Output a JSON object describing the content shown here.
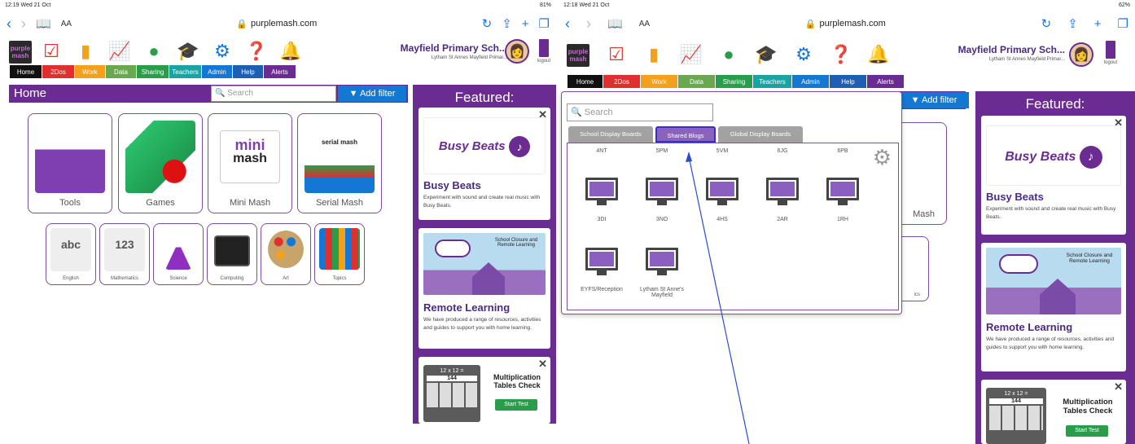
{
  "left": {
    "status_time": "12:19  Wed 21 Oct",
    "status_right": "81%",
    "url": "purplemash.com",
    "aa": "AA",
    "tabs": [
      "Home",
      "2Dos",
      "Work",
      "Data",
      "Sharing",
      "Teachers",
      "Admin",
      "Help",
      "Alerts"
    ],
    "school_name": "Mayfield Primary Sch...",
    "school_sub": "Lytham St Annes Mayfield Primar...",
    "logout": "logout",
    "page_title": "Home",
    "search_placeholder": "Search",
    "add_filter": "Add filter",
    "big_cards": [
      "Tools",
      "Games",
      "Mini Mash",
      "Serial Mash"
    ],
    "small_cards": [
      "English",
      "Mathematics",
      "Science",
      "Computing",
      "Art",
      "Topics"
    ],
    "featured_title": "Featured:",
    "feat1_title": "Busy Beats",
    "feat1_desc": "Experiment with sound and create real music with Busy Beats.",
    "feat2_title": "Remote Learning",
    "feat2_desc": "We have produced a range of resources, activities and guides to support you with home learning.",
    "feat3_q": "12 x 12 =",
    "feat3_a": "144",
    "feat3_title": "Multiplication Tables Check",
    "feat3_btn": "Start Test",
    "feat2_img_text": "School Closure and Remote Learning",
    "busy_img_text": "Busy Beats",
    "mini_text_top": "mini",
    "mini_text_bottom": "mash",
    "serial_text": "serial mash"
  },
  "right": {
    "status_time": "12:18  Wed 21 Oct",
    "status_right": "62%",
    "url": "purplemash.com",
    "aa": "AA",
    "tabs": [
      "Home",
      "2Dos",
      "Work",
      "Data",
      "Sharing",
      "Teachers",
      "Admin",
      "Help",
      "Alerts"
    ],
    "school_name": "Mayfield Primary Sch...",
    "school_sub": "Lytham St Annes Mayfield Primar...",
    "logout": "logout",
    "add_filter": "Add filter",
    "partial_label": "Mash",
    "partial_small": "ics",
    "featured_title": "Featured:",
    "feat1_title": "Busy Beats",
    "feat1_desc": "Experiment with sound and create real music with Busy Beats.",
    "feat2_title": "Remote Learning",
    "feat2_desc": "We have produced a range of resources, activities and guides to support you with home learning.",
    "feat2_img_text": "School Closure and Remote Learning",
    "busy_img_text": "Busy Beats",
    "feat3_q": "12 x 12 =",
    "feat3_a": "144",
    "feat3_title": "Multiplication Tables Check",
    "feat3_btn": "Start Test",
    "dropdown": {
      "search_placeholder": "Search",
      "tabs": [
        "School Display Boards",
        "Shared Blogs",
        "Global Display Boards"
      ],
      "active_tab": "Shared Blogs",
      "top_labels": [
        "4NT",
        "5PM",
        "5VM",
        "6JG",
        "6PB"
      ],
      "row1_labels": [
        "3DI",
        "3NO",
        "4HS",
        "2AR",
        "1RH"
      ],
      "row2_labels": [
        "EYFS/Reception",
        "Lytham St Anne's Mayfield"
      ]
    }
  },
  "colors": {
    "purple": "#6b2c91",
    "blue": "#1577d4",
    "tab_home": "#111111",
    "tab_2dos": "#e02f2f",
    "tab_work": "#f3a01c",
    "tab_data": "#6aa84f",
    "tab_sharing": "#2a9d4a",
    "tab_teachers": "#1aa3a3",
    "tab_admin": "#1577d4",
    "tab_help": "#1d5fb3",
    "tab_alerts": "#6b2c91"
  }
}
